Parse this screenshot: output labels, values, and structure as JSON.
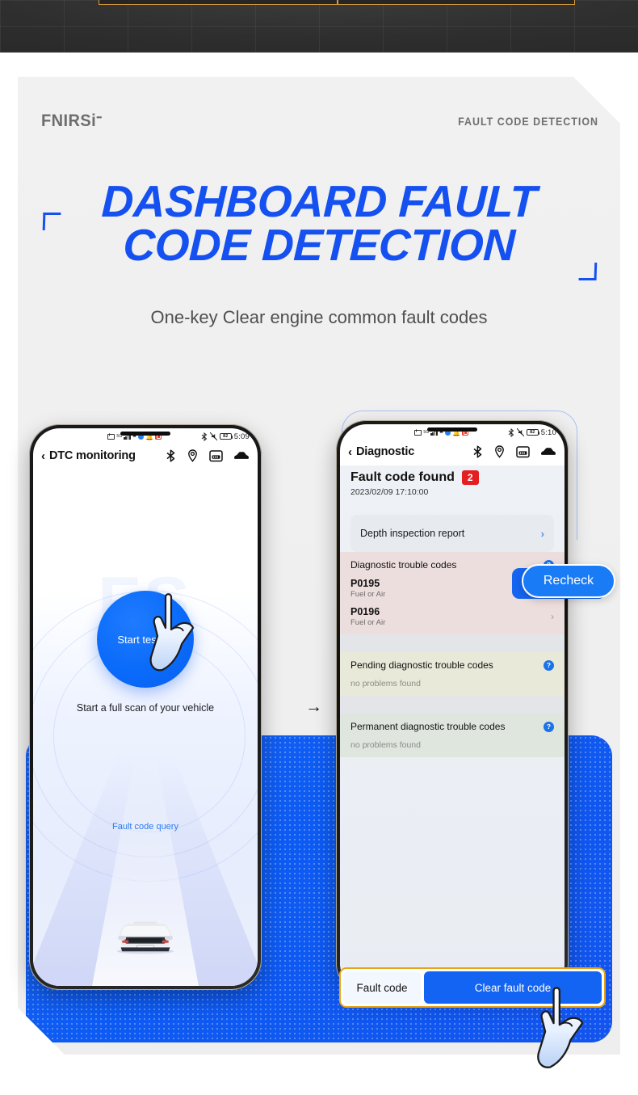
{
  "brand": {
    "logo": "FNIRSi",
    "kicker": "FAULT CODE DETECTION"
  },
  "hero": {
    "title_line1": "DASHBOARD FAULT",
    "title_line2": "CODE DETECTION",
    "subtitle": "One-key Clear engine common fault codes",
    "title_color": "#1550f0"
  },
  "arrow_glyph": "→",
  "phone_left": {
    "status": {
      "time": "5:09",
      "battery": "82",
      "icons": [
        "mail-icon",
        "signal-icon",
        "wifi-icon",
        "blue-dot-icon",
        "bell-icon",
        "qq-icon"
      ],
      "right_icons": [
        "bluetooth-icon",
        "mute-icon",
        "battery-icon"
      ]
    },
    "header": {
      "back": "‹",
      "title": "DTC monitoring",
      "icons": [
        "bluetooth-icon",
        "location-icon",
        "obd-icon",
        "car-icon"
      ]
    },
    "start_button": "Start testing",
    "caption": "Start a full scan of your vehicle",
    "link": "Fault code query",
    "watermark": "FS"
  },
  "phone_right": {
    "status": {
      "time": "5:10",
      "battery": "82",
      "icons": [
        "mail-icon",
        "signal-icon",
        "wifi-icon",
        "blue-dot-icon",
        "bell-icon",
        "qq-icon"
      ],
      "right_icons": [
        "bluetooth-icon",
        "mute-icon",
        "battery-icon"
      ]
    },
    "header": {
      "back": "‹",
      "title": "Diagnostic",
      "icons": [
        "bluetooth-icon",
        "location-icon",
        "obd-icon",
        "car-icon"
      ]
    },
    "fault_found_label": "Fault code found",
    "fault_count": "2",
    "timestamp": "2023/02/09 17:10:00",
    "depth_report": "Depth inspection report",
    "chevron": "›",
    "help_glyph": "?",
    "sections": [
      {
        "title": "Diagnostic trouble codes",
        "codes": [
          {
            "code": "P0195",
            "desc": "Fuel or Air"
          },
          {
            "code": "P0196",
            "desc": "Fuel or Air"
          }
        ]
      },
      {
        "title": "Pending diagnostic trouble codes",
        "empty": "no problems found"
      },
      {
        "title": "Permanent diagnostic trouble codes",
        "empty": "no problems found"
      }
    ]
  },
  "callouts": {
    "recheck": "Recheck",
    "fault_code": "Fault code",
    "clear_fault_code": "Clear fault code"
  },
  "colors": {
    "brand_blue": "#1550f0",
    "panel_blue": "#0d5bf2",
    "badge_red": "#e31f21",
    "callout_border": "#e8a417"
  }
}
